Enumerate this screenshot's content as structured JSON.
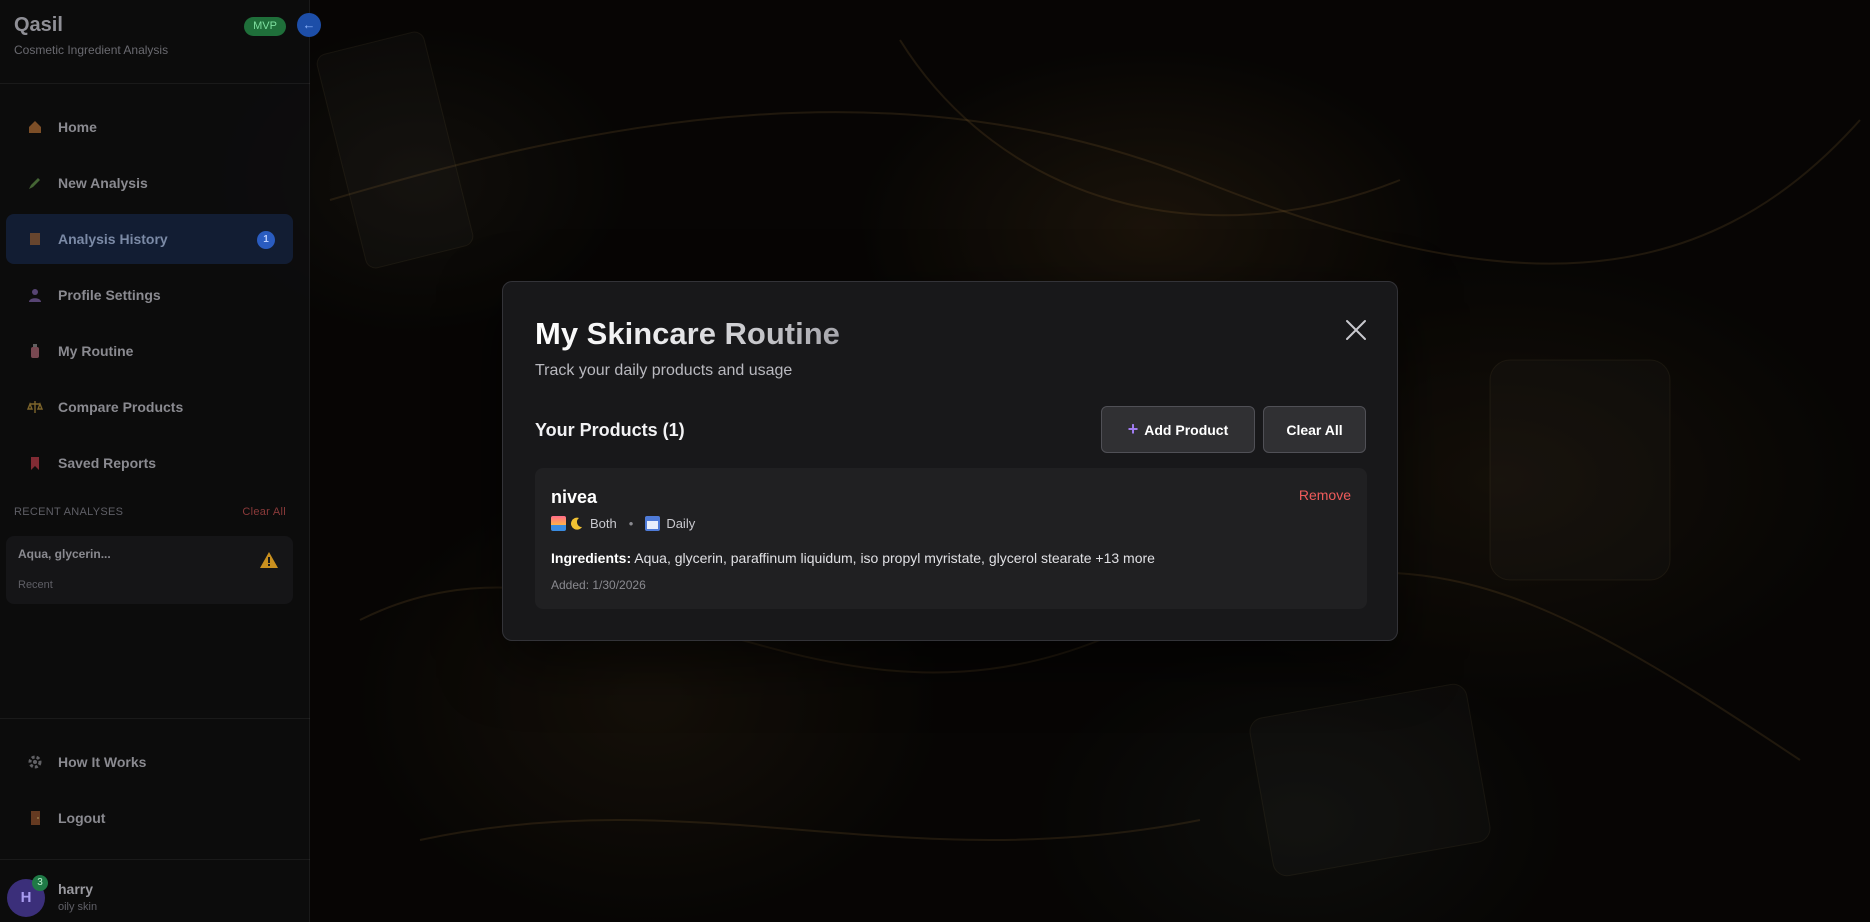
{
  "app": {
    "name": "Qasil",
    "subtitle": "Cosmetic Ingredient Analysis",
    "badge": "MVP",
    "collapse_icon": "←"
  },
  "sidebar": {
    "items": [
      {
        "label": "Home",
        "icon": "home-icon"
      },
      {
        "label": "New Analysis",
        "icon": "pencil-icon"
      },
      {
        "label": "Analysis History",
        "icon": "book-icon",
        "badge": "1",
        "active": true
      },
      {
        "label": "Profile Settings",
        "icon": "user-icon"
      },
      {
        "label": "My Routine",
        "icon": "bottle-icon"
      },
      {
        "label": "Compare Products",
        "icon": "scale-icon"
      },
      {
        "label": "Saved Reports",
        "icon": "bookmark-icon"
      }
    ],
    "recent": {
      "heading": "RECENT ANALYSES",
      "clear_label": "Clear All",
      "items": [
        {
          "title": "Aqua, glycerin...",
          "sub": "Recent",
          "icon": "warning-icon"
        }
      ]
    },
    "bottom_items": [
      {
        "label": "How It Works",
        "icon": "gear-icon"
      },
      {
        "label": "Logout",
        "icon": "door-icon"
      }
    ],
    "user": {
      "initial": "H",
      "badge": "3",
      "name": "harry",
      "sub": "oily skin"
    }
  },
  "modal": {
    "title": "My Skincare Routine",
    "subtitle": "Track your daily products and usage",
    "products_heading": "Your Products (1)",
    "add_button": "Add Product",
    "clear_button": "Clear All",
    "products": [
      {
        "name": "nivea",
        "time": "Both",
        "frequency": "Daily",
        "ingredients_label": "Ingredients:",
        "ingredients": "Aqua, glycerin, paraffinum liquidum, iso propyl myristate, glycerol stearate +13 more",
        "added": "Added: 1/30/2026",
        "remove_label": "Remove"
      }
    ]
  },
  "colors": {
    "accent": "#a07cf0",
    "danger": "#ef5b5b",
    "active_nav": "#182c54",
    "mvp": "#1f6f3a"
  }
}
